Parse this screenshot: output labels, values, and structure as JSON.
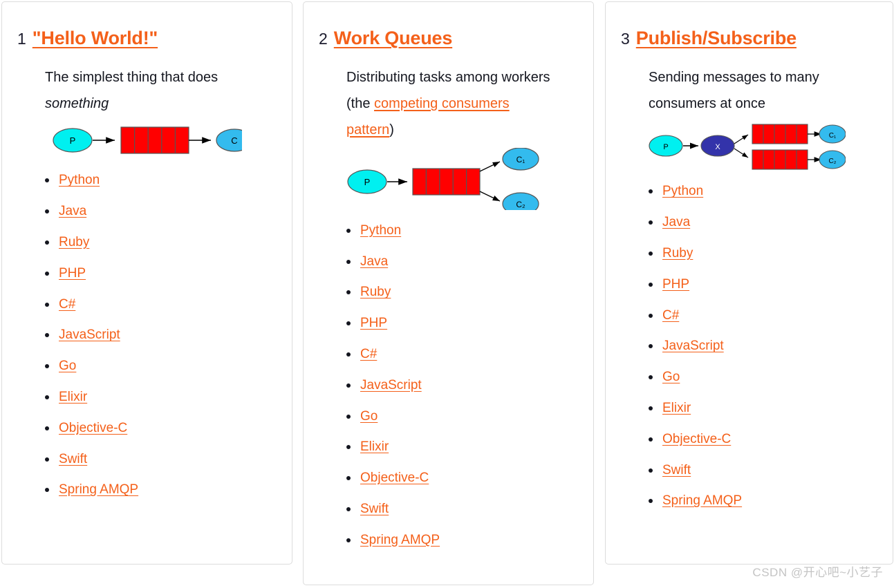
{
  "cards": [
    {
      "number": "1",
      "title": "\"Hello World!\"",
      "description_prefix": "The simplest thing that does ",
      "description_em": "something",
      "description_suffix": "",
      "diagram": "hello-world-diagram",
      "languages": [
        "Python",
        "Java",
        "Ruby",
        "PHP",
        "C#",
        "JavaScript",
        "Go",
        "Elixir",
        "Objective-C",
        "Swift",
        "Spring AMQP"
      ]
    },
    {
      "number": "2",
      "title": "Work Queues",
      "description_prefix": "Distributing tasks among workers (the ",
      "description_link": "competing consumers pattern",
      "description_suffix": ")",
      "diagram": "work-queues-diagram",
      "languages": [
        "Python",
        "Java",
        "Ruby",
        "PHP",
        "C#",
        "JavaScript",
        "Go",
        "Elixir",
        "Objective-C",
        "Swift",
        "Spring AMQP"
      ]
    },
    {
      "number": "3",
      "title": "Publish/Subscribe",
      "description_prefix": "Sending messages to many consumers at once",
      "diagram": "publish-subscribe-diagram",
      "languages": [
        "Python",
        "Java",
        "Ruby",
        "PHP",
        "C#",
        "JavaScript",
        "Go",
        "Elixir",
        "Objective-C",
        "Swift",
        "Spring AMQP"
      ]
    }
  ],
  "diagram_labels": {
    "producer": "P",
    "consumer": "C",
    "consumer_1": "C₁",
    "consumer_2": "C₂",
    "exchange": "X"
  },
  "colors": {
    "link": "#f4601a",
    "text": "#14161f",
    "card_border": "#dcdcdc",
    "producer_fill": "#00f0f0",
    "consumer_fill": "#33bbee",
    "exchange_fill": "#3333aa",
    "queue_fill": "#ff0000",
    "watermark": "#c4c4c4"
  },
  "watermark": "CSDN @开心吧~小艺子"
}
